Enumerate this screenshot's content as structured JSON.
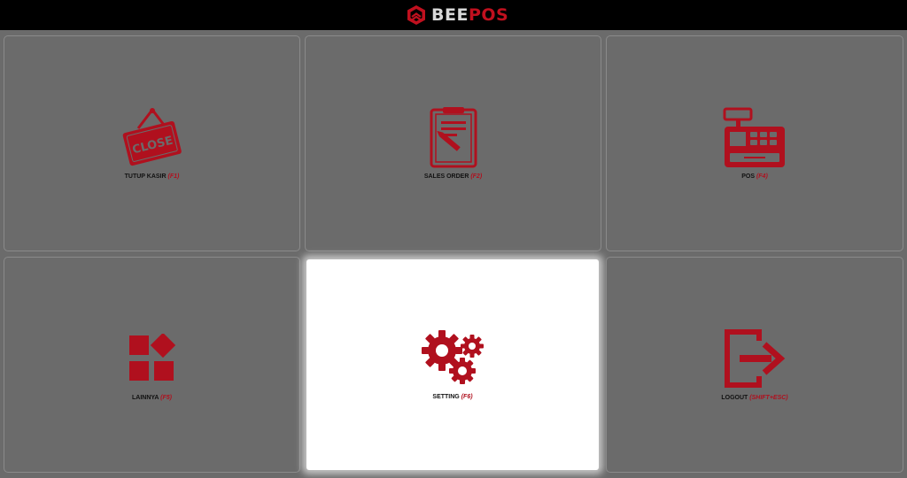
{
  "header": {
    "brand_bee": "BEE",
    "brand_pos": "POS",
    "logo_icon": "hexagon-logo-icon"
  },
  "menu": {
    "tutup_kasir": {
      "label": "TUTUP KASIR",
      "shortcut": "(F1)",
      "icon": "close-sign-icon"
    },
    "sales_order": {
      "label": "SALES ORDER",
      "shortcut": "(F2)",
      "icon": "clipboard-pen-icon"
    },
    "pos": {
      "label": "POS",
      "shortcut": "(F4)",
      "icon": "cash-register-icon"
    },
    "lainnya": {
      "label": "LAINNYA",
      "shortcut": "(F5)",
      "icon": "apps-grid-icon"
    },
    "setting": {
      "label": "SETTING",
      "shortcut": "(F6)",
      "icon": "gears-icon",
      "selected": true
    },
    "logout": {
      "label": "LOGOUT",
      "shortcut": "(SHIFT+ESC)",
      "icon": "logout-icon"
    },
    "close_sign_text": "CLOSE"
  },
  "colors": {
    "accent": "#b0101e",
    "background": "#6b6b6b",
    "topbar": "#000000",
    "selected_tile": "#ffffff"
  }
}
